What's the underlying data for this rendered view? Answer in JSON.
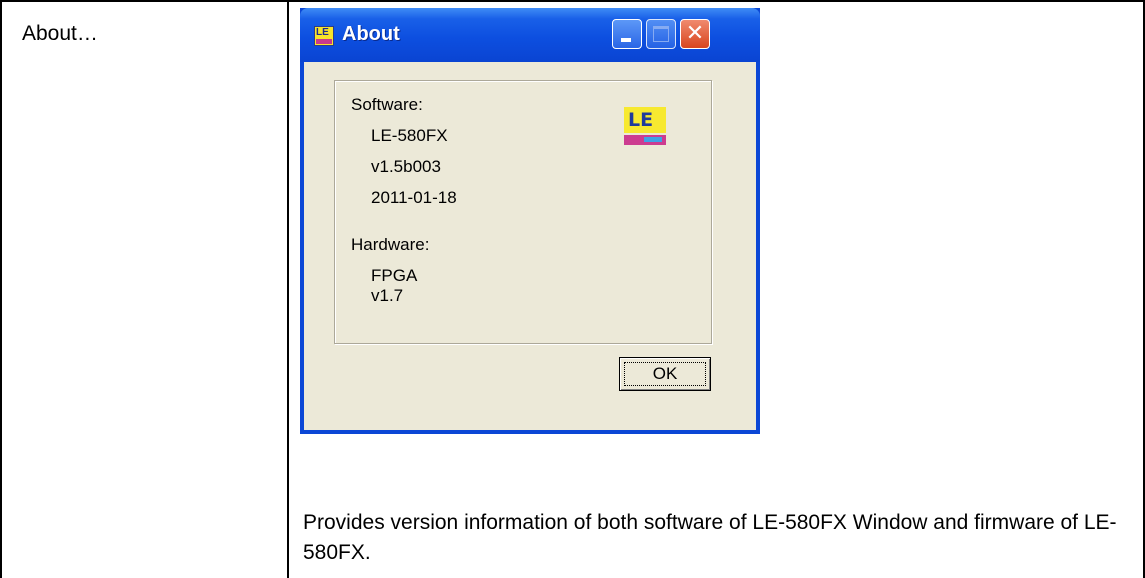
{
  "document": {
    "menu_item_label": "About…",
    "description": "Provides version information of both software of LE-580FX Window and firmware of LE-580FX."
  },
  "window": {
    "title": "About",
    "icon": "le-app-icon",
    "icon_text": "LE",
    "buttons": {
      "minimize": "minimize-icon",
      "maximize": "maximize-icon",
      "close": "close-icon"
    }
  },
  "about": {
    "software_label": "Software:",
    "software_name": "LE-580FX",
    "software_version": "v1.5b003",
    "software_date": "2011-01-18",
    "hardware_label": "Hardware:",
    "hardware_name": "FPGA",
    "hardware_version": "v1.7",
    "logo_text": "LE",
    "ok_label": "OK"
  },
  "colors": {
    "titlebar": "#0d4fe0",
    "client_bg": "#ece9d8",
    "close_button": "#d8451e",
    "logo_yellow": "#f7e930",
    "logo_magenta": "#cc3c90"
  }
}
